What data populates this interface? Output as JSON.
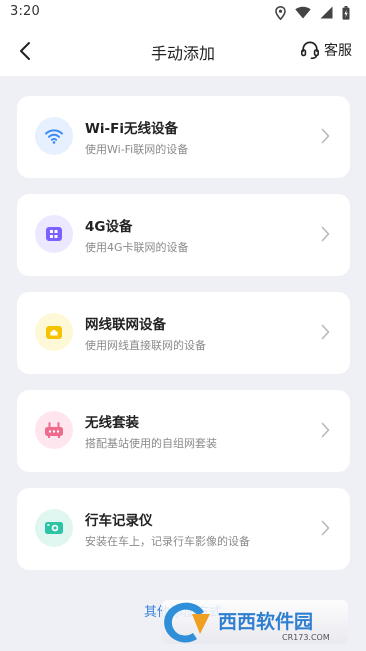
{
  "status_bar": {
    "time": "3:20",
    "icons": [
      "location-icon",
      "wifi-icon",
      "cellular-signal-icon",
      "battery-icon"
    ]
  },
  "header": {
    "title": "手动添加",
    "back_icon": "back-arrow-icon",
    "customer_service_label": "客服",
    "customer_service_icon": "headset-icon"
  },
  "device_types": [
    {
      "title": "Wi-Fi无线设备",
      "subtitle": "使用Wi-Fi联网的设备",
      "icon": "wifi-icon",
      "icon_color": "#3d8af7",
      "icon_bg": "#e6f0ff"
    },
    {
      "title": "4G设备",
      "subtitle": "使用4G卡联网的设备",
      "icon": "sim-card-icon",
      "icon_color": "#7b61ff",
      "icon_bg": "#ece8ff"
    },
    {
      "title": "网线联网设备",
      "subtitle": "使用网线直接联网的设备",
      "icon": "ethernet-icon",
      "icon_color": "#f5c400",
      "icon_bg": "#fff8d6"
    },
    {
      "title": "无线套装",
      "subtitle": "搭配基站使用的自组网套装",
      "icon": "router-icon",
      "icon_color": "#f06a8e",
      "icon_bg": "#ffe6ee"
    },
    {
      "title": "行车记录仪",
      "subtitle": "安装在车上，记录行车影像的设备",
      "icon": "dashcam-icon",
      "icon_color": "#2cc4a4",
      "icon_bg": "#dff7f0"
    }
  ],
  "other_methods_link": "其他添加方式",
  "watermark": {
    "text": "西西软件园",
    "domain": "CR173.COM"
  },
  "colors": {
    "background": "#eff0f5",
    "card": "#ffffff",
    "link": "#3b82d8",
    "subtitle": "#8a8a8a"
  }
}
